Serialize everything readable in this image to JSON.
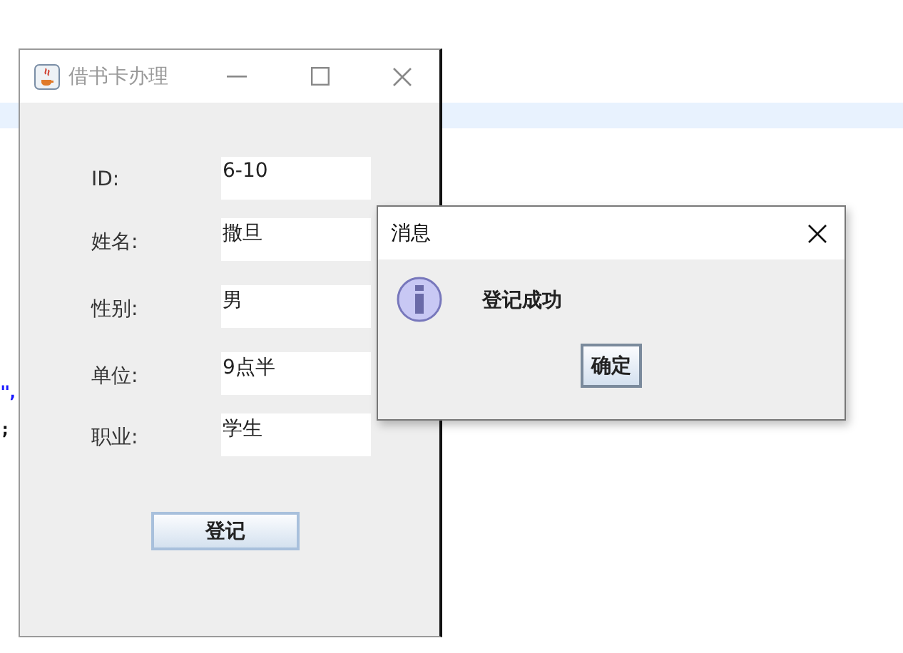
{
  "editor": {
    "code_fragments": [
      "\",",
      ";"
    ]
  },
  "main_window": {
    "title": "借书卡办理",
    "fields": [
      {
        "label": "ID:",
        "value": "6-10"
      },
      {
        "label": "姓名:",
        "value": "撒旦"
      },
      {
        "label": "性别:",
        "value": "男"
      },
      {
        "label": "单位:",
        "value": "9点半"
      },
      {
        "label": "职业:",
        "value": "学生"
      }
    ],
    "submit_button": "登记"
  },
  "dialog": {
    "title": "消息",
    "message": "登记成功",
    "ok_button": "确定"
  }
}
